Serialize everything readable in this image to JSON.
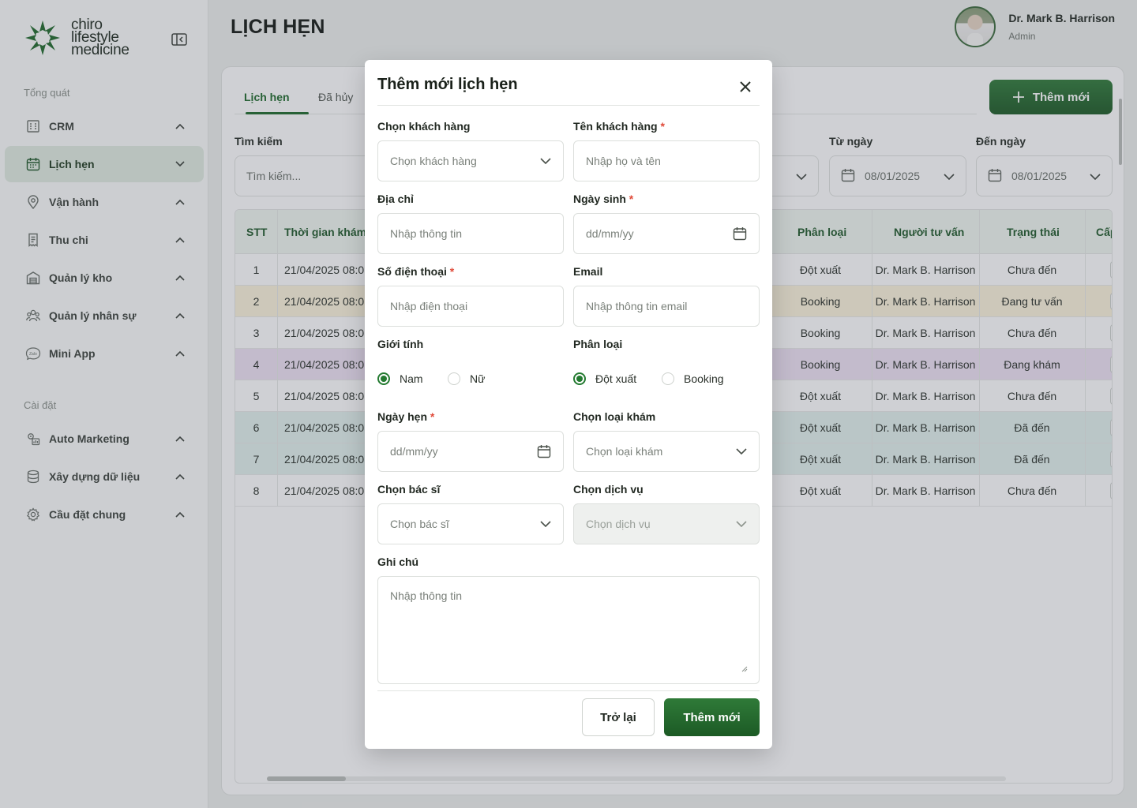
{
  "brand": {
    "line1": "chiro",
    "line2": "lifestyle",
    "line3": "medicine"
  },
  "sidebar": {
    "section_overview": "Tổng quát",
    "section_settings": "Cài đặt",
    "items": [
      {
        "label": "CRM",
        "icon": "building-icon"
      },
      {
        "label": "Lịch hẹn",
        "icon": "calendar-icon"
      },
      {
        "label": "Vận hành",
        "icon": "location-pin-icon"
      },
      {
        "label": "Thu chi",
        "icon": "receipt-icon"
      },
      {
        "label": "Quản lý kho",
        "icon": "warehouse-icon"
      },
      {
        "label": "Quản lý nhân sự",
        "icon": "people-icon"
      },
      {
        "label": "Mini App",
        "icon": "zalo-icon"
      },
      {
        "label": "Auto Marketing",
        "icon": "marketing-icon"
      },
      {
        "label": "Xây dựng dữ liệu",
        "icon": "database-icon"
      },
      {
        "label": "Cầu đặt chung",
        "icon": "settings-icon"
      }
    ]
  },
  "header": {
    "title": "LỊCH HẸN"
  },
  "user": {
    "name": "Dr. Mark B. Harrison",
    "role": "Admin"
  },
  "tabs": {
    "appointments": "Lịch hẹn",
    "cancelled": "Đã hủy"
  },
  "add_button": "Thêm mới",
  "filters": {
    "search_label": "Tìm kiếm",
    "search_placeholder": "Tìm kiếm...",
    "from_label": "Từ ngày",
    "from_value": "08/01/2025",
    "to_label": "Đến ngày",
    "to_value": "08/01/2025"
  },
  "table": {
    "headers": {
      "stt": "STT",
      "time": "Thời gian khám",
      "type": "Phân loại",
      "consultant": "Người tư vấn",
      "status": "Trạng thái",
      "level": "Cấp"
    },
    "rows": [
      {
        "stt": "1",
        "time": "21/04/2025 08:0",
        "type": "Đột xuất",
        "consultant": "Dr. Mark B. Harrison",
        "status": "Chưa đến"
      },
      {
        "stt": "2",
        "time": "21/04/2025 08:0",
        "type": "Booking",
        "consultant": "Dr. Mark B. Harrison",
        "status": "Đang tư vấn"
      },
      {
        "stt": "3",
        "time": "21/04/2025 08:0",
        "type": "Booking",
        "consultant": "Dr. Mark B. Harrison",
        "status": "Chưa đến"
      },
      {
        "stt": "4",
        "time": "21/04/2025 08:0",
        "type": "Booking",
        "consultant": "Dr. Mark B. Harrison",
        "status": "Đang khám"
      },
      {
        "stt": "5",
        "time": "21/04/2025 08:0",
        "type": "Đột xuất",
        "consultant": "Dr. Mark B. Harrison",
        "status": "Chưa đến"
      },
      {
        "stt": "6",
        "time": "21/04/2025 08:0",
        "type": "Đột xuất",
        "consultant": "Dr. Mark B. Harrison",
        "status": "Đã đến"
      },
      {
        "stt": "7",
        "time": "21/04/2025 08:0",
        "type": "Đột xuất",
        "consultant": "Dr. Mark B. Harrison",
        "status": "Đã đến"
      },
      {
        "stt": "8",
        "time": "21/04/2025 08:0",
        "type": "Đột xuất",
        "consultant": "Dr. Mark B. Harrison",
        "status": "Chưa đến"
      }
    ],
    "row_colors": [
      "#ffffff",
      "#fdf4dc",
      "#ffffff",
      "#efe3f4",
      "#ffffff",
      "#e3f2ee",
      "#e3f2ee",
      "#ffffff"
    ]
  },
  "modal": {
    "title": "Thêm mới lịch hẹn",
    "customer_select_label": "Chọn khách hàng",
    "customer_select_placeholder": "Chọn khách hàng",
    "customer_name_label": "Tên khách hàng",
    "customer_name_placeholder": "Nhập họ và tên",
    "address_label": "Địa chỉ",
    "address_placeholder": "Nhập thông tin",
    "birthday_label": "Ngày sinh",
    "birthday_placeholder": "dd/mm/yy",
    "phone_label": "Số điện thoại",
    "phone_placeholder": "Nhập điện thoại",
    "email_label": "Email",
    "email_placeholder": "Nhập thông tin email",
    "gender_label": "Giới tính",
    "gender_male": "Nam",
    "gender_female": "Nữ",
    "category_label": "Phân loại",
    "category_walkin": "Đột xuất",
    "category_booking": "Booking",
    "appointment_date_label": "Ngày hẹn",
    "appointment_date_placeholder": "dd/mm/yy",
    "exam_type_label": "Chọn loại khám",
    "exam_type_placeholder": "Chọn loại khám",
    "doctor_label": "Chọn bác sĩ",
    "doctor_placeholder": "Chọn bác sĩ",
    "service_label": "Chọn dịch vụ",
    "service_placeholder": "Chọn dịch vụ",
    "note_label": "Ghi chú",
    "note_placeholder": "Nhập thông tin",
    "required_mark": "*",
    "back_button": "Trở lại",
    "submit_button": "Thêm mới"
  },
  "colors": {
    "brand_green": "#1e6a2b",
    "required_red": "#e04b3a"
  }
}
